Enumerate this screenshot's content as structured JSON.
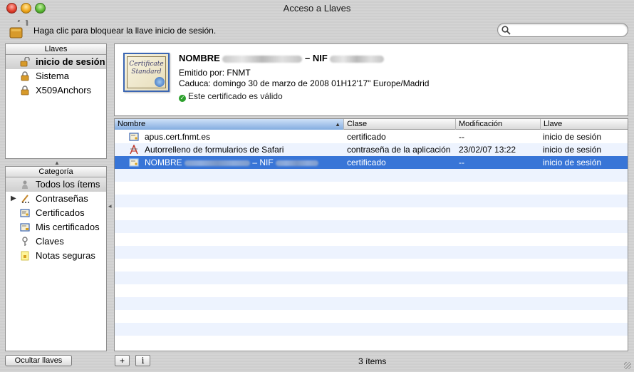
{
  "window": {
    "title": "Acceso a Llaves"
  },
  "toolbar": {
    "lock_text": "Haga clic para bloquear la llave inicio de sesión.",
    "search_placeholder": "",
    "search_value": ""
  },
  "keychains": {
    "header": "Llaves",
    "items": [
      {
        "label": "inicio de sesión",
        "icon": "unlocked-padlock-icon",
        "selected": true
      },
      {
        "label": "Sistema",
        "icon": "padlock-icon",
        "selected": false
      },
      {
        "label": "X509Anchors",
        "icon": "padlock-icon",
        "selected": false
      }
    ]
  },
  "categories": {
    "header": "Categoría",
    "items": [
      {
        "label": "Todos los ítems",
        "icon": "people-icon",
        "selected": true
      },
      {
        "label": "Contraseñas",
        "icon": "pencil-icon",
        "selected": false,
        "expandable": true
      },
      {
        "label": "Certificados",
        "icon": "certificate-icon",
        "selected": false
      },
      {
        "label": "Mis certificados",
        "icon": "my-certificate-icon",
        "selected": false
      },
      {
        "label": "Claves",
        "icon": "key-icon",
        "selected": false
      },
      {
        "label": "Notas seguras",
        "icon": "note-icon",
        "selected": false
      }
    ]
  },
  "info": {
    "name_prefix": "NOMBRE",
    "name_mid": "– NIF",
    "issuer": "Emitido por: FNMT",
    "expiry": "Caduca: domingo 30 de marzo de 2008 01H12'17\" Europe/Madrid",
    "status": "Este certificado es válido",
    "cert_image_text": "Certificate Standard"
  },
  "table": {
    "columns": [
      "Nombre",
      "Clase",
      "Modificación",
      "Llave"
    ],
    "sorted_column": "Nombre",
    "rows": [
      {
        "name": "apus.cert.fnmt.es",
        "class": "certificado",
        "modified": "--",
        "keychain": "inicio de sesión",
        "icon": "certificate-icon",
        "selected": false
      },
      {
        "name": "Autorrelleno de formularios de Safari",
        "class": "contraseña de la aplicación",
        "modified": "23/02/07 13:22",
        "keychain": "inicio de sesión",
        "icon": "application-password-icon",
        "selected": false
      },
      {
        "name_prefix": "NOMBRE",
        "name_mid": "– NIF",
        "class": "certificado",
        "modified": "--",
        "keychain": "inicio de sesión",
        "icon": "certificate-icon",
        "selected": true
      }
    ]
  },
  "bottom": {
    "hide_button": "Ocultar llaves",
    "add_button": "+",
    "info_button": "i",
    "item_count": "3 ítems"
  }
}
